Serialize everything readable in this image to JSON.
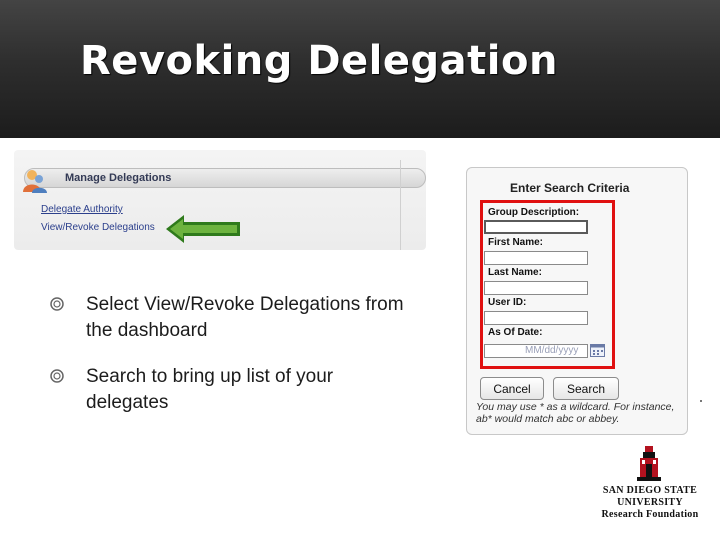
{
  "slide": {
    "title": "Revoking Delegation"
  },
  "dashboard": {
    "header_label": "Manage Delegations",
    "links": [
      "Delegate Authority",
      "View/Revoke Delegations"
    ]
  },
  "bullets": [
    "Select View/Revoke Delegations from the dashboard",
    "Search to bring up list of your delegates"
  ],
  "search_dialog": {
    "title": "Enter Search Criteria",
    "fields": [
      {
        "label": "Group Description:",
        "value": ""
      },
      {
        "label": "First Name:",
        "value": ""
      },
      {
        "label": "Last Name:",
        "value": ""
      },
      {
        "label": "User ID:",
        "value": ""
      },
      {
        "label": "As Of Date:",
        "value": "",
        "placeholder": "MM/dd/yyyy"
      }
    ],
    "buttons": {
      "cancel": "Cancel",
      "search": "Search"
    },
    "hint": "You may use * as a wildcard. For instance, ab* would match abc or abbey."
  },
  "logo": {
    "line1": "SAN DIEGO STATE",
    "line2": "UNIVERSITY",
    "line3": "Research Foundation"
  },
  "colors": {
    "title_bar": "#2e2e2e",
    "highlight_box": "#e01010",
    "arrow": "#6db33f",
    "logo_red": "#b3121f"
  },
  "icons": {
    "bullet": "ring-bullet-icon",
    "dashboard": "delegation-people-icon",
    "calendar": "calendar-icon",
    "arrow": "left-arrow-icon"
  }
}
